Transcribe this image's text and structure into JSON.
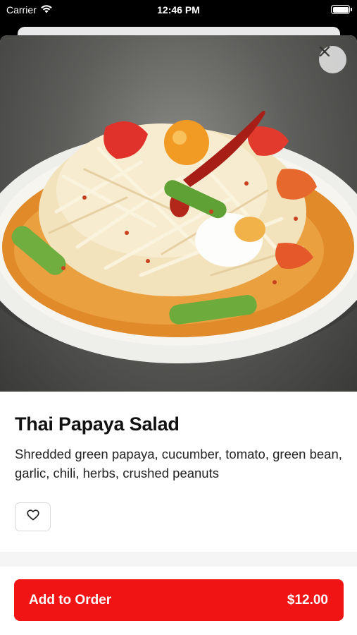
{
  "status_bar": {
    "carrier": "Carrier",
    "time": "12:46 PM"
  },
  "item": {
    "title": "Thai Papaya Salad",
    "description": "Shredded green papaya, cucumber, tomato, green bean, garlic, chili, herbs, crushed peanuts"
  },
  "actions": {
    "add_label": "Add to Order",
    "price": "$12.00"
  },
  "icons": {
    "close": "close-icon",
    "favorite": "heart-outline-icon",
    "wifi": "wifi-icon",
    "battery": "battery-icon"
  },
  "colors": {
    "accent": "#f01414",
    "background": "#ffffff",
    "status_bar": "#000000"
  }
}
